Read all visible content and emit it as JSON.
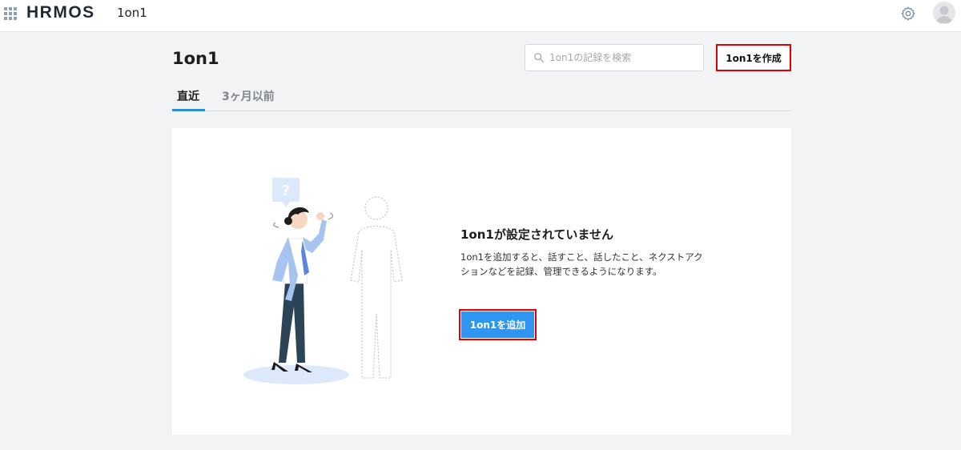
{
  "header": {
    "logo_text": "HRMOS",
    "app_name": "1on1",
    "icons": [
      "apps-grid-icon",
      "gear-icon",
      "user-avatar"
    ]
  },
  "page": {
    "title": "1on1",
    "search": {
      "placeholder": "1on1の記録を検索",
      "value": ""
    },
    "create_button_label": "1on1を作成"
  },
  "tabs": [
    {
      "label": "直近",
      "active": true
    },
    {
      "label": "3ヶ月以前",
      "active": false
    }
  ],
  "empty_state": {
    "title": "1on1が設定されていません",
    "description_line1": "1on1を追加すると、話すこと、話したこと、ネクストアク",
    "description_line2": "ションなどを記録、管理できるようになります。",
    "add_button_label": "1on1を追加",
    "illustration_icon": "question-mark"
  },
  "colors": {
    "accent": "#2e96f0",
    "tab_underline": "#2b8cd8",
    "highlight_border": "#e00000",
    "page_background": "#f2f3f5"
  }
}
